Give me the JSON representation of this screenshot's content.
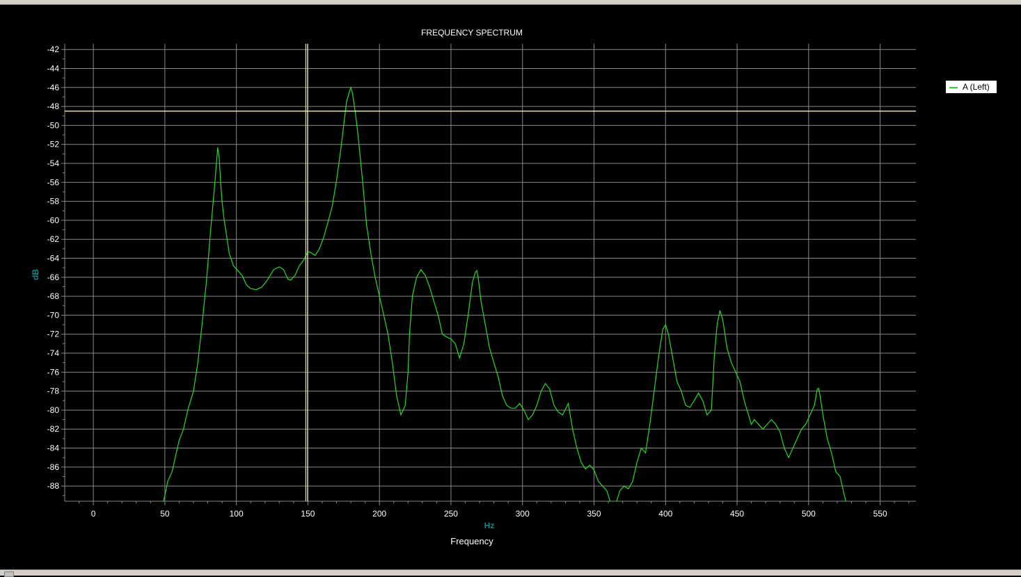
{
  "chart_data": {
    "type": "line",
    "title": "FREQUENCY SPECTRUM",
    "xlabel": "Frequency",
    "x_unit": "Hz",
    "ylabel": "dB",
    "xlim": [
      -20,
      575
    ],
    "ylim": [
      -89.6,
      -41.4
    ],
    "x_ticks": [
      0,
      50,
      100,
      150,
      200,
      250,
      300,
      350,
      400,
      450,
      500,
      550
    ],
    "y_ticks": [
      -42,
      -44,
      -46,
      -48,
      -50,
      -52,
      -54,
      -56,
      -58,
      -60,
      -62,
      -64,
      -66,
      -68,
      -70,
      -72,
      -74,
      -76,
      -78,
      -80,
      -82,
      -84,
      -86,
      -88
    ],
    "grid": true,
    "legend_position": "top-right",
    "cursor": {
      "x": 149,
      "y": -48.5
    },
    "colors": {
      "background": "#000000",
      "grid": "#8a8a8a",
      "series": "#22dd22",
      "cursor": "#e6e08c",
      "axis_unit": "#0f8a8a"
    },
    "series": [
      {
        "name": "A (Left)",
        "x": [
          49,
          50,
          52,
          55,
          58,
          60,
          63,
          66,
          70,
          73,
          76,
          79,
          82,
          85,
          86,
          87,
          88,
          89,
          90,
          91,
          93,
          95,
          98,
          101,
          104,
          107,
          110,
          114,
          118,
          122,
          126,
          130,
          133,
          136,
          138,
          141,
          144,
          147,
          150,
          152,
          155,
          158,
          161,
          164,
          167,
          170,
          173,
          175,
          177,
          179,
          180,
          181,
          183,
          185,
          188,
          191,
          194,
          197,
          200,
          203,
          206,
          209,
          212,
          215,
          218,
          220,
          221,
          223,
          226,
          229,
          232,
          235,
          238,
          241,
          244,
          247,
          250,
          253,
          256,
          259,
          262,
          265,
          267,
          268,
          269,
          271,
          274,
          277,
          280,
          283,
          286,
          289,
          292,
          295,
          298,
          301,
          304,
          307,
          310,
          313,
          316,
          319,
          322,
          325,
          328,
          332,
          335,
          338,
          341,
          344,
          347,
          350,
          353,
          356,
          359,
          362,
          365,
          368,
          371,
          374,
          377,
          380,
          383,
          386,
          389,
          392,
          395,
          398,
          400,
          402,
          405,
          408,
          411,
          414,
          417,
          420,
          423,
          426,
          429,
          432,
          434,
          436,
          438,
          440,
          443,
          446,
          449,
          452,
          455,
          458,
          460,
          462,
          465,
          468,
          471,
          474,
          477,
          480,
          483,
          486,
          489,
          492,
          495,
          498,
          501,
          504,
          506,
          507,
          508,
          510,
          513,
          516,
          519,
          522,
          525,
          526
        ],
        "y": [
          -89.6,
          -89.0,
          -87.5,
          -86.5,
          -84.5,
          -83.2,
          -82.0,
          -80.0,
          -78.0,
          -75.0,
          -71.0,
          -66.5,
          -61.0,
          -56.0,
          -54.0,
          -52.3,
          -53.5,
          -56.0,
          -58.0,
          -59.5,
          -61.5,
          -63.5,
          -64.8,
          -65.3,
          -65.8,
          -66.8,
          -67.2,
          -67.3,
          -67.0,
          -66.2,
          -65.2,
          -64.9,
          -65.2,
          -66.2,
          -66.3,
          -65.8,
          -64.8,
          -64.2,
          -63.3,
          -63.4,
          -63.7,
          -63.0,
          -61.8,
          -60.2,
          -58.5,
          -55.8,
          -52.5,
          -50.0,
          -47.5,
          -46.5,
          -46.0,
          -46.5,
          -48.5,
          -51.0,
          -55.5,
          -60.5,
          -63.5,
          -66.0,
          -68.0,
          -70.0,
          -72.0,
          -75.0,
          -78.5,
          -80.5,
          -79.5,
          -76.0,
          -72.0,
          -68.0,
          -66.0,
          -65.2,
          -65.8,
          -67.0,
          -68.5,
          -70.0,
          -72.0,
          -72.3,
          -72.5,
          -73.0,
          -74.5,
          -73.0,
          -70.0,
          -66.5,
          -65.5,
          -65.3,
          -66.0,
          -68.5,
          -71.0,
          -73.5,
          -75.0,
          -76.5,
          -78.5,
          -79.5,
          -79.8,
          -79.8,
          -79.3,
          -80.0,
          -81.0,
          -80.5,
          -79.5,
          -78.0,
          -77.2,
          -77.8,
          -79.5,
          -80.2,
          -80.5,
          -79.3,
          -82.0,
          -84.0,
          -85.5,
          -86.2,
          -85.8,
          -86.3,
          -87.5,
          -88.0,
          -88.5,
          -90.0,
          -90.0,
          -88.5,
          -88.0,
          -88.3,
          -87.5,
          -85.5,
          -84.0,
          -84.5,
          -81.5,
          -78.0,
          -74.5,
          -71.5,
          -71.0,
          -72.0,
          -74.5,
          -77.0,
          -78.0,
          -79.5,
          -79.7,
          -79.0,
          -78.2,
          -79.0,
          -80.5,
          -80.0,
          -74.5,
          -71.0,
          -69.5,
          -70.5,
          -73.5,
          -75.0,
          -76.0,
          -77.0,
          -79.0,
          -80.5,
          -81.5,
          -81.0,
          -81.5,
          -82.0,
          -81.5,
          -81.0,
          -81.5,
          -82.3,
          -84.0,
          -85.0,
          -84.0,
          -83.0,
          -82.0,
          -81.5,
          -80.5,
          -79.5,
          -77.8,
          -77.7,
          -78.5,
          -80.5,
          -83.0,
          -84.5,
          -86.5,
          -87.0,
          -89.0,
          -89.6
        ]
      }
    ]
  }
}
